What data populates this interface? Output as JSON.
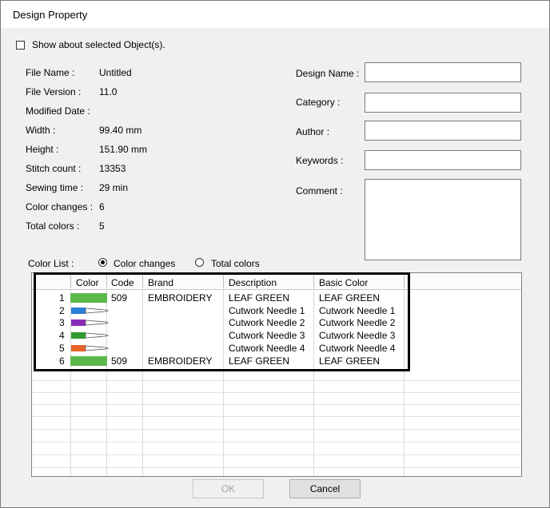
{
  "window": {
    "title": "Design Property"
  },
  "show_selected": {
    "label": "Show about selected Object(s).",
    "checked": false
  },
  "info": [
    {
      "label": "File Name :",
      "value": "Untitled"
    },
    {
      "label": "File Version :",
      "value": "11.0"
    },
    {
      "label": "Modified Date :",
      "value": ""
    },
    {
      "label": "Width :",
      "value": "99.40 mm"
    },
    {
      "label": "Height :",
      "value": "151.90 mm"
    },
    {
      "label": "Stitch count :",
      "value": "13353"
    },
    {
      "label": "Sewing time :",
      "value": "29 min"
    },
    {
      "label": "Color changes :",
      "value": "6"
    },
    {
      "label": "Total colors :",
      "value": "5"
    }
  ],
  "fields": {
    "design_name": {
      "label": "Design Name :",
      "value": ""
    },
    "category": {
      "label": "Category :",
      "value": ""
    },
    "author": {
      "label": "Author :",
      "value": ""
    },
    "keywords": {
      "label": "Keywords :",
      "value": ""
    },
    "comment": {
      "label": "Comment :",
      "value": ""
    }
  },
  "color_list": {
    "label": "Color List :",
    "options": [
      {
        "label": "Color changes",
        "selected": true
      },
      {
        "label": "Total colors",
        "selected": false
      }
    ],
    "columns": [
      "Color",
      "Code",
      "Brand",
      "Description",
      "Basic Color"
    ],
    "rows": [
      {
        "num": "1",
        "swatch": "#5cb84a",
        "swatch_icon": "color-swatch",
        "code": "509",
        "brand": "EMBROIDERY",
        "description": "LEAF GREEN",
        "basic": "LEAF GREEN"
      },
      {
        "num": "2",
        "swatch": "#2b7fd6",
        "swatch_icon": "cutwork-needle-icon",
        "code": "",
        "brand": "",
        "description": "Cutwork Needle 1",
        "basic": "Cutwork Needle 1"
      },
      {
        "num": "3",
        "swatch": "#8a2ab8",
        "swatch_icon": "cutwork-needle-icon",
        "code": "",
        "brand": "",
        "description": "Cutwork Needle 2",
        "basic": "Cutwork Needle 2"
      },
      {
        "num": "4",
        "swatch": "#2f9a2f",
        "swatch_icon": "cutwork-needle-icon",
        "code": "",
        "brand": "",
        "description": "Cutwork Needle 3",
        "basic": "Cutwork Needle 3"
      },
      {
        "num": "5",
        "swatch": "#e8632a",
        "swatch_icon": "cutwork-needle-icon",
        "code": "",
        "brand": "",
        "description": "Cutwork Needle 4",
        "basic": "Cutwork Needle 4"
      },
      {
        "num": "6",
        "swatch": "#5cb84a",
        "swatch_icon": "color-swatch",
        "code": "509",
        "brand": "EMBROIDERY",
        "description": "LEAF GREEN",
        "basic": "LEAF GREEN"
      }
    ]
  },
  "buttons": {
    "ok": "OK",
    "cancel": "Cancel"
  }
}
